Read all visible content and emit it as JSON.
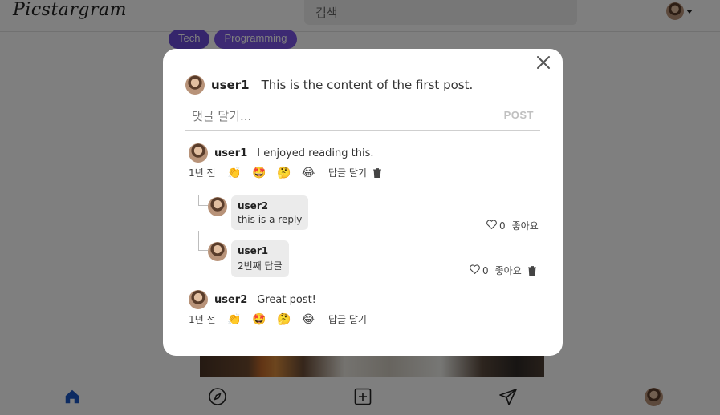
{
  "app": {
    "logo": "Picstargram"
  },
  "search": {
    "placeholder": "검색"
  },
  "tags": [
    "Tech",
    "Programming"
  ],
  "post": {
    "author": "user1",
    "content": "This is the content of the first post."
  },
  "comment_form": {
    "placeholder": "댓글 달기...",
    "submit_label": "POST"
  },
  "comments": [
    {
      "author": "user1",
      "text": "I enjoyed reading this.",
      "time": "1년 전",
      "emojis": [
        "👏",
        "🤩",
        "🤔",
        "😂"
      ],
      "reply_label": "답글 달기",
      "replies": [
        {
          "author": "user2",
          "text": "this is a reply",
          "likes": "0",
          "like_label": "좋아요"
        },
        {
          "author": "user1",
          "text": "2번째 답글",
          "likes": "0",
          "like_label": "좋아요"
        }
      ]
    },
    {
      "author": "user2",
      "text": "Great post!",
      "time": "1년 전",
      "emojis": [
        "👏",
        "🤩",
        "🤔",
        "😂"
      ],
      "reply_label": "답글 달기"
    }
  ],
  "bottom_nav": [
    "home-icon",
    "compass-icon",
    "add-post-icon",
    "send-icon",
    "profile-avatar"
  ],
  "colors": {
    "accent": "#1a56c4",
    "tag": "#6a4bd8",
    "overlay": "rgba(0,0,0,0.5)"
  }
}
